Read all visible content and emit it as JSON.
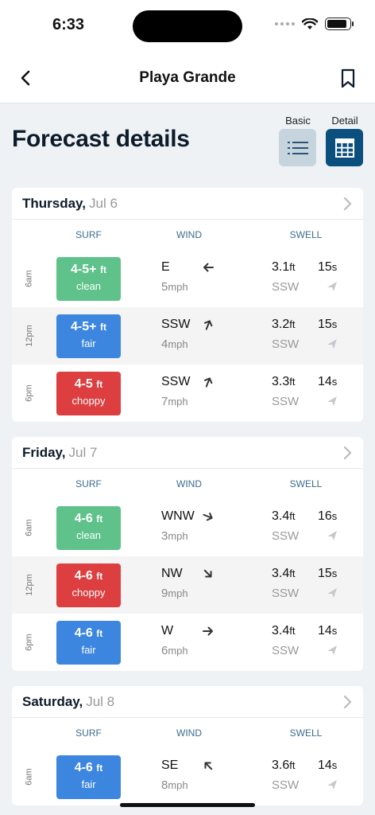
{
  "status": {
    "time": "6:33",
    "battery_level": 0.9
  },
  "nav": {
    "title": "Playa Grande"
  },
  "page": {
    "title": "Forecast details"
  },
  "views": {
    "basic_label": "Basic",
    "detail_label": "Detail",
    "selected": "Detail"
  },
  "columns": {
    "surf": "SURF",
    "wind": "WIND",
    "swell": "SWELL"
  },
  "colors": {
    "clean": "#5ec28a",
    "fair": "#3d86e0",
    "choppy": "#dd3e3f"
  },
  "days": [
    {
      "day": "Thursday,",
      "date": "Jul 6",
      "rows": [
        {
          "time": "6am",
          "surf_height": "4-5+",
          "surf_unit": "ft",
          "condition": "clean",
          "wind_dir": "E",
          "wind_arrow_deg": 270,
          "wind_speed": "5",
          "wind_unit": "mph",
          "swell_height": "3.1",
          "swell_unit": "ft",
          "swell_dir": "SSW",
          "period": "15",
          "period_unit": "s"
        },
        {
          "time": "12pm",
          "surf_height": "4-5+",
          "surf_unit": "ft",
          "condition": "fair",
          "wind_dir": "SSW",
          "wind_arrow_deg": 22,
          "wind_speed": "4",
          "wind_unit": "mph",
          "swell_height": "3.2",
          "swell_unit": "ft",
          "swell_dir": "SSW",
          "period": "15",
          "period_unit": "s"
        },
        {
          "time": "6pm",
          "surf_height": "4-5",
          "surf_unit": "ft",
          "condition": "choppy",
          "wind_dir": "SSW",
          "wind_arrow_deg": 22,
          "wind_speed": "7",
          "wind_unit": "mph",
          "swell_height": "3.3",
          "swell_unit": "ft",
          "swell_dir": "SSW",
          "period": "14",
          "period_unit": "s"
        }
      ]
    },
    {
      "day": "Friday,",
      "date": "Jul 7",
      "rows": [
        {
          "time": "6am",
          "surf_height": "4-6",
          "surf_unit": "ft",
          "condition": "clean",
          "wind_dir": "WNW",
          "wind_arrow_deg": 112,
          "wind_speed": "3",
          "wind_unit": "mph",
          "swell_height": "3.4",
          "swell_unit": "ft",
          "swell_dir": "SSW",
          "period": "16",
          "period_unit": "s"
        },
        {
          "time": "12pm",
          "surf_height": "4-6",
          "surf_unit": "ft",
          "condition": "choppy",
          "wind_dir": "NW",
          "wind_arrow_deg": 135,
          "wind_speed": "9",
          "wind_unit": "mph",
          "swell_height": "3.4",
          "swell_unit": "ft",
          "swell_dir": "SSW",
          "period": "15",
          "period_unit": "s"
        },
        {
          "time": "6pm",
          "surf_height": "4-6",
          "surf_unit": "ft",
          "condition": "fair",
          "wind_dir": "W",
          "wind_arrow_deg": 90,
          "wind_speed": "6",
          "wind_unit": "mph",
          "swell_height": "3.4",
          "swell_unit": "ft",
          "swell_dir": "SSW",
          "period": "14",
          "period_unit": "s"
        }
      ]
    },
    {
      "day": "Saturday,",
      "date": "Jul 8",
      "rows": [
        {
          "time": "6am",
          "surf_height": "4-6",
          "surf_unit": "ft",
          "condition": "fair",
          "wind_dir": "SE",
          "wind_arrow_deg": 315,
          "wind_speed": "8",
          "wind_unit": "mph",
          "swell_height": "3.6",
          "swell_unit": "ft",
          "swell_dir": "SSW",
          "period": "14",
          "period_unit": "s"
        }
      ]
    }
  ]
}
